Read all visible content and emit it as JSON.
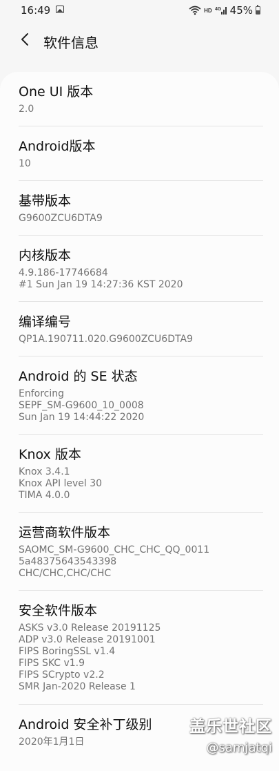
{
  "status_bar": {
    "time": "16:49",
    "network_label": "HD",
    "signal_label": "4G",
    "battery": "45%"
  },
  "header": {
    "title": "软件信息"
  },
  "items": [
    {
      "title": "One UI 版本",
      "lines": [
        "2.0"
      ]
    },
    {
      "title": "Android版本",
      "lines": [
        "10"
      ]
    },
    {
      "title": "基带版本",
      "lines": [
        "G9600ZCU6DTA9"
      ]
    },
    {
      "title": "内核版本",
      "lines": [
        "4.9.186-17746684",
        "#1 Sun Jan 19 14:27:36 KST 2020"
      ]
    },
    {
      "title": "编译编号",
      "lines": [
        "QP1A.190711.020.G9600ZCU6DTA9"
      ]
    },
    {
      "title": "Android 的 SE 状态",
      "lines": [
        "Enforcing",
        "SEPF_SM-G9600_10_0008",
        "Sun Jan 19 14:44:22 2020"
      ]
    },
    {
      "title": "Knox 版本",
      "lines": [
        "Knox 3.4.1",
        "Knox API level 30",
        "TIMA 4.0.0"
      ]
    },
    {
      "title": "运营商软件版本",
      "lines": [
        "SAOMC_SM-G9600_CHC_CHC_QQ_0011",
        "5a48375643543398",
        "CHC/CHC,CHC/CHC"
      ]
    },
    {
      "title": "安全软件版本",
      "lines": [
        "ASKS v3.0 Release 20191125",
        "ADP v3.0 Release 20191001",
        "FIPS BoringSSL v1.4",
        "FIPS SKC v1.9",
        "FIPS SCrypto v2.2",
        "SMR Jan-2020 Release 1"
      ]
    },
    {
      "title": "Android 安全补丁级别",
      "lines": [
        "2020年1月1日"
      ]
    }
  ],
  "watermark": {
    "brand": "盖乐世社区",
    "user": "@samjatqi"
  }
}
